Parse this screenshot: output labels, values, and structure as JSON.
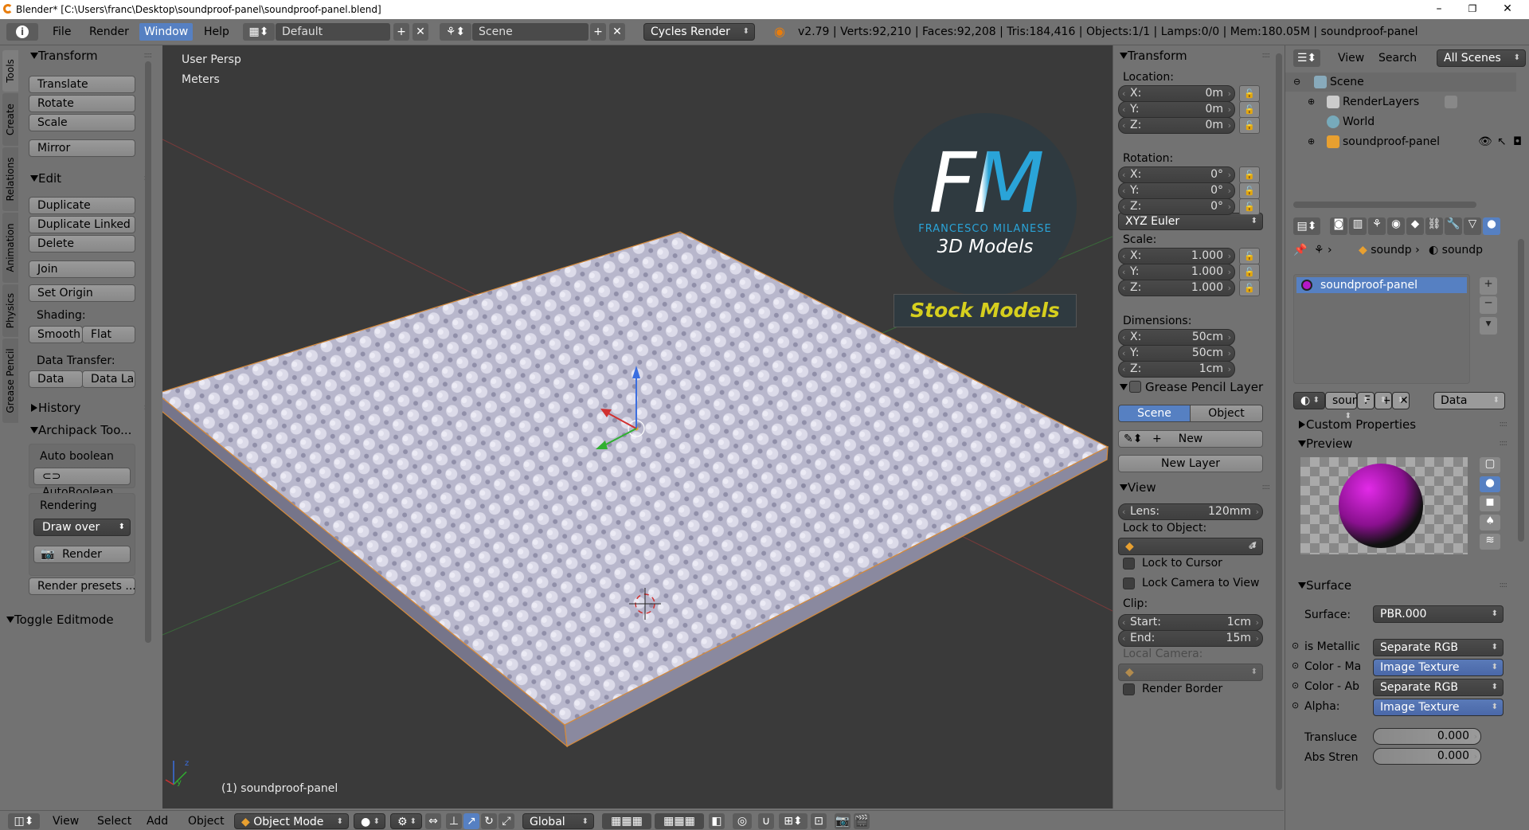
{
  "window": {
    "title": "Blender* [C:\\Users\\franc\\Desktop\\soundproof-panel\\soundproof-panel.blend]",
    "minimize": "–",
    "maximize": "❐",
    "close": "✕"
  },
  "topbar": {
    "info_icon": "i",
    "menus": [
      "File",
      "Render",
      "Window",
      "Help"
    ],
    "active_menu": "Window",
    "screen_layout": "Default",
    "scene": "Scene",
    "engine": "Cycles Render",
    "stats": "v2.79 | Verts:92,210 | Faces:92,208 | Tris:184,416 | Objects:1/1 | Lamps:0/0 | Mem:180.05M | soundproof-panel"
  },
  "tool_tabs": [
    "Tools",
    "Create",
    "Relations",
    "Animation",
    "Physics",
    "Grease Pencil"
  ],
  "toolshelf": {
    "transform": {
      "header": "Transform",
      "translate": "Translate",
      "rotate": "Rotate",
      "scale": "Scale",
      "mirror": "Mirror"
    },
    "edit": {
      "header": "Edit",
      "duplicate": "Duplicate",
      "duplicate_linked": "Duplicate Linked",
      "delete": "Delete",
      "join": "Join",
      "set_origin": "Set Origin",
      "shading_label": "Shading:",
      "smooth": "Smooth",
      "flat": "Flat",
      "data_transfer_label": "Data Transfer:",
      "data": "Data",
      "data_la": "Data La"
    },
    "history": "History",
    "archipack": {
      "header": "Archipack Too...",
      "auto_boolean_label": "Auto boolean",
      "auto_boolean_btn": "AutoBoolean",
      "rendering_label": "Rendering",
      "draw_over": "Draw over",
      "render_btn": "Render",
      "render_presets": "Render presets ..."
    },
    "toggle_editmode": "Toggle Editmode"
  },
  "viewport": {
    "view_name": "User Persp",
    "units": "Meters",
    "object_label": "(1) soundproof-panel",
    "logo": {
      "letters": "FM",
      "name": "FRANCESCO MILANESE",
      "sub": "3D Models",
      "banner": "Stock Models"
    }
  },
  "npanel": {
    "transform_header": "Transform",
    "location_label": "Location:",
    "location": [
      {
        "k": "X:",
        "v": "0m"
      },
      {
        "k": "Y:",
        "v": "0m"
      },
      {
        "k": "Z:",
        "v": "0m"
      }
    ],
    "rotation_label": "Rotation:",
    "rotation": [
      {
        "k": "X:",
        "v": "0°"
      },
      {
        "k": "Y:",
        "v": "0°"
      },
      {
        "k": "Z:",
        "v": "0°"
      }
    ],
    "rotation_mode": "XYZ Euler",
    "scale_label": "Scale:",
    "scale": [
      {
        "k": "X:",
        "v": "1.000"
      },
      {
        "k": "Y:",
        "v": "1.000"
      },
      {
        "k": "Z:",
        "v": "1.000"
      }
    ],
    "dimensions_label": "Dimensions:",
    "dimensions": [
      {
        "k": "X:",
        "v": "50cm"
      },
      {
        "k": "Y:",
        "v": "50cm"
      },
      {
        "k": "Z:",
        "v": "1cm"
      }
    ],
    "grease_header": "Grease Pencil Layer",
    "scene_btn": "Scene",
    "object_btn": "Object",
    "new_btn": "New",
    "new_layer_btn": "New Layer",
    "view_header": "View",
    "lens_label": "Lens:",
    "lens_value": "120mm",
    "lock_to_object": "Lock to Object:",
    "lock_to_cursor": "Lock to Cursor",
    "lock_camera": "Lock Camera to View",
    "clip_label": "Clip:",
    "clip_start_label": "Start:",
    "clip_start": "1cm",
    "clip_end_label": "End:",
    "clip_end": "15m",
    "local_camera": "Local Camera:",
    "render_border": "Render Border"
  },
  "outliner": {
    "view": "View",
    "search": "Search",
    "filter": "All Scenes",
    "rows": [
      "Scene",
      "RenderLayers",
      "World",
      "soundproof-panel"
    ]
  },
  "properties": {
    "breadcrumb1": "soundp",
    "breadcrumb2": "soundp",
    "material_slot": "soundproof-panel",
    "mat_name": "soun",
    "mat_f": "F",
    "link": "Data",
    "custom_props": "Custom Properties",
    "preview": "Preview",
    "surface_header": "Surface",
    "surface_label": "Surface:",
    "surface_value": "PBR.000",
    "sockets": [
      {
        "label": "is Metallic",
        "value": "Separate RGB"
      },
      {
        "label": "Color - Ma",
        "value": "Image Texture"
      },
      {
        "label": "Color - Ab",
        "value": "Separate RGB"
      },
      {
        "label": "Alpha:",
        "value": "Image Texture"
      }
    ],
    "translucence_label": "Transluce",
    "translucence_value": "0.000",
    "abs_label": "Abs Stren",
    "abs_value": "0.000"
  },
  "bottombar": {
    "view": "View",
    "select": "Select",
    "add": "Add",
    "object": "Object",
    "mode": "Object Mode",
    "orientation": "Global"
  }
}
